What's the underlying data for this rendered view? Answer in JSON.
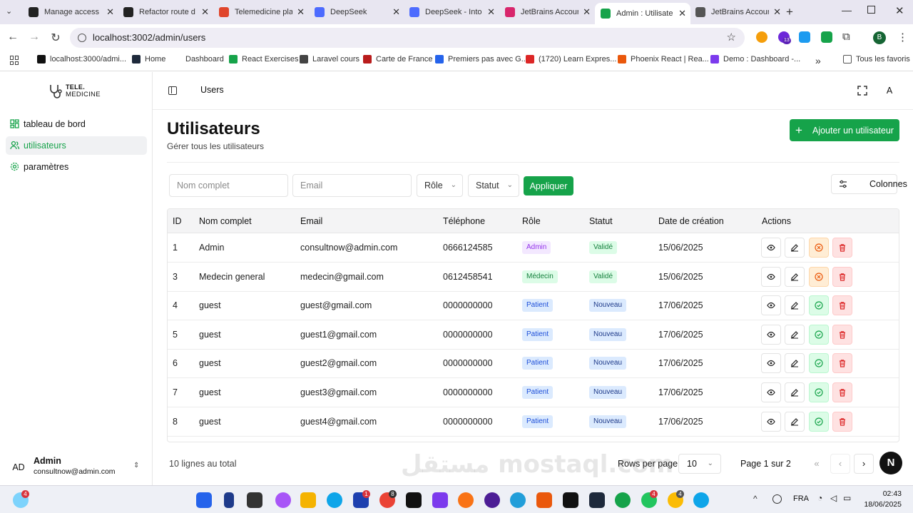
{
  "browser": {
    "tabs": [
      {
        "label": "Manage access",
        "color": "#222222",
        "active": false
      },
      {
        "label": "Refactor route d",
        "color": "#222222",
        "active": false
      },
      {
        "label": "Telemedicine pla",
        "color": "#e0452b",
        "active": false
      },
      {
        "label": "DeepSeek",
        "color": "#4d6bfe",
        "active": false
      },
      {
        "label": "DeepSeek - Into",
        "color": "#4d6bfe",
        "active": false
      },
      {
        "label": "JetBrains Accoun",
        "color": "#d8266c",
        "active": false
      },
      {
        "label": "Admin : Utilisate",
        "color": "#16a34a",
        "active": true
      },
      {
        "label": "JetBrains Accoun",
        "color": "#555555",
        "active": false
      }
    ],
    "new_tab": "+",
    "url": "localhost:3002/admin/users",
    "bookmarks": [
      "localhost:3000/admi...",
      "Home",
      "Dashboard",
      "React Exercises",
      "Laravel cours",
      "Carte de France",
      "Premiers pas avec G...",
      "(1720) Learn Expres...",
      "Phoenix React | Rea...",
      "Demo : Dashboard -..."
    ],
    "all_bookmarks": "Tous les favoris",
    "profile_initial": "B",
    "ext_badge": "13"
  },
  "sidebar": {
    "logo_line1": "TELE.",
    "logo_line2": "MEDICINE",
    "items": [
      {
        "label": "tableau de bord",
        "active": false
      },
      {
        "label": "utilisateurs",
        "active": true
      },
      {
        "label": "paramètres",
        "active": false
      }
    ],
    "user": {
      "initials": "AD",
      "name": "Admin",
      "email": "consultnow@admin.com"
    }
  },
  "topbar": {
    "breadcrumb": "Users",
    "avatar": "A"
  },
  "page": {
    "title": "Utilisateurs",
    "subtitle": "Gérer tous les utilisateurs",
    "add_button": "Ajouter un utilisateur"
  },
  "filters": {
    "name_placeholder": "Nom complet",
    "email_placeholder": "Email",
    "role_label": "Rôle",
    "status_label": "Statut",
    "apply_label": "Appliquer",
    "columns_label": "Colonnes"
  },
  "table": {
    "headers": [
      "ID",
      "Nom complet",
      "Email",
      "Téléphone",
      "Rôle",
      "Statut",
      "Date de création",
      "Actions"
    ],
    "rows": [
      {
        "id": "1",
        "name": "Admin",
        "email": "consultnow@admin.com",
        "phone": "0666124585",
        "role": "Admin",
        "role_class": "admin",
        "status": "Validé",
        "status_class": "valide",
        "date": "15/06/2025",
        "toggle": "warn"
      },
      {
        "id": "3",
        "name": "Medecin general",
        "email": "medecin@gmail.com",
        "phone": "0612458541",
        "role": "Médecin",
        "role_class": "medecin",
        "status": "Validé",
        "status_class": "valide",
        "date": "15/06/2025",
        "toggle": "warn"
      },
      {
        "id": "4",
        "name": "guest",
        "email": "guest@gmail.com",
        "phone": "0000000000",
        "role": "Patient",
        "role_class": "patient",
        "status": "Nouveau",
        "status_class": "nouveau",
        "date": "17/06/2025",
        "toggle": "ok"
      },
      {
        "id": "5",
        "name": "guest",
        "email": "guest1@gmail.com",
        "phone": "0000000000",
        "role": "Patient",
        "role_class": "patient",
        "status": "Nouveau",
        "status_class": "nouveau",
        "date": "17/06/2025",
        "toggle": "ok"
      },
      {
        "id": "6",
        "name": "guest",
        "email": "guest2@gmail.com",
        "phone": "0000000000",
        "role": "Patient",
        "role_class": "patient",
        "status": "Nouveau",
        "status_class": "nouveau",
        "date": "17/06/2025",
        "toggle": "ok"
      },
      {
        "id": "7",
        "name": "guest",
        "email": "guest3@gmail.com",
        "phone": "0000000000",
        "role": "Patient",
        "role_class": "patient",
        "status": "Nouveau",
        "status_class": "nouveau",
        "date": "17/06/2025",
        "toggle": "ok"
      },
      {
        "id": "8",
        "name": "guest",
        "email": "guest4@gmail.com",
        "phone": "0000000000",
        "role": "Patient",
        "role_class": "patient",
        "status": "Nouveau",
        "status_class": "nouveau",
        "date": "17/06/2025",
        "toggle": "ok"
      }
    ]
  },
  "pagination": {
    "total": "10 lignes au total",
    "rows_per_page_label": "Rows per page",
    "rows_per_page_value": "10",
    "page_info": "Page 1 sur 2",
    "next_badge": "N"
  },
  "taskbar": {
    "lang": "FRA",
    "time": "02:43",
    "date": "18/06/2025",
    "weather_badge": "4",
    "app_badges": [
      "1",
      "8",
      "4",
      "4"
    ]
  },
  "watermark": "مستقل mostaql.com",
  "colors": {
    "accent": "#16a34a",
    "danger": "#dc2626",
    "warning": "#ea580c"
  }
}
